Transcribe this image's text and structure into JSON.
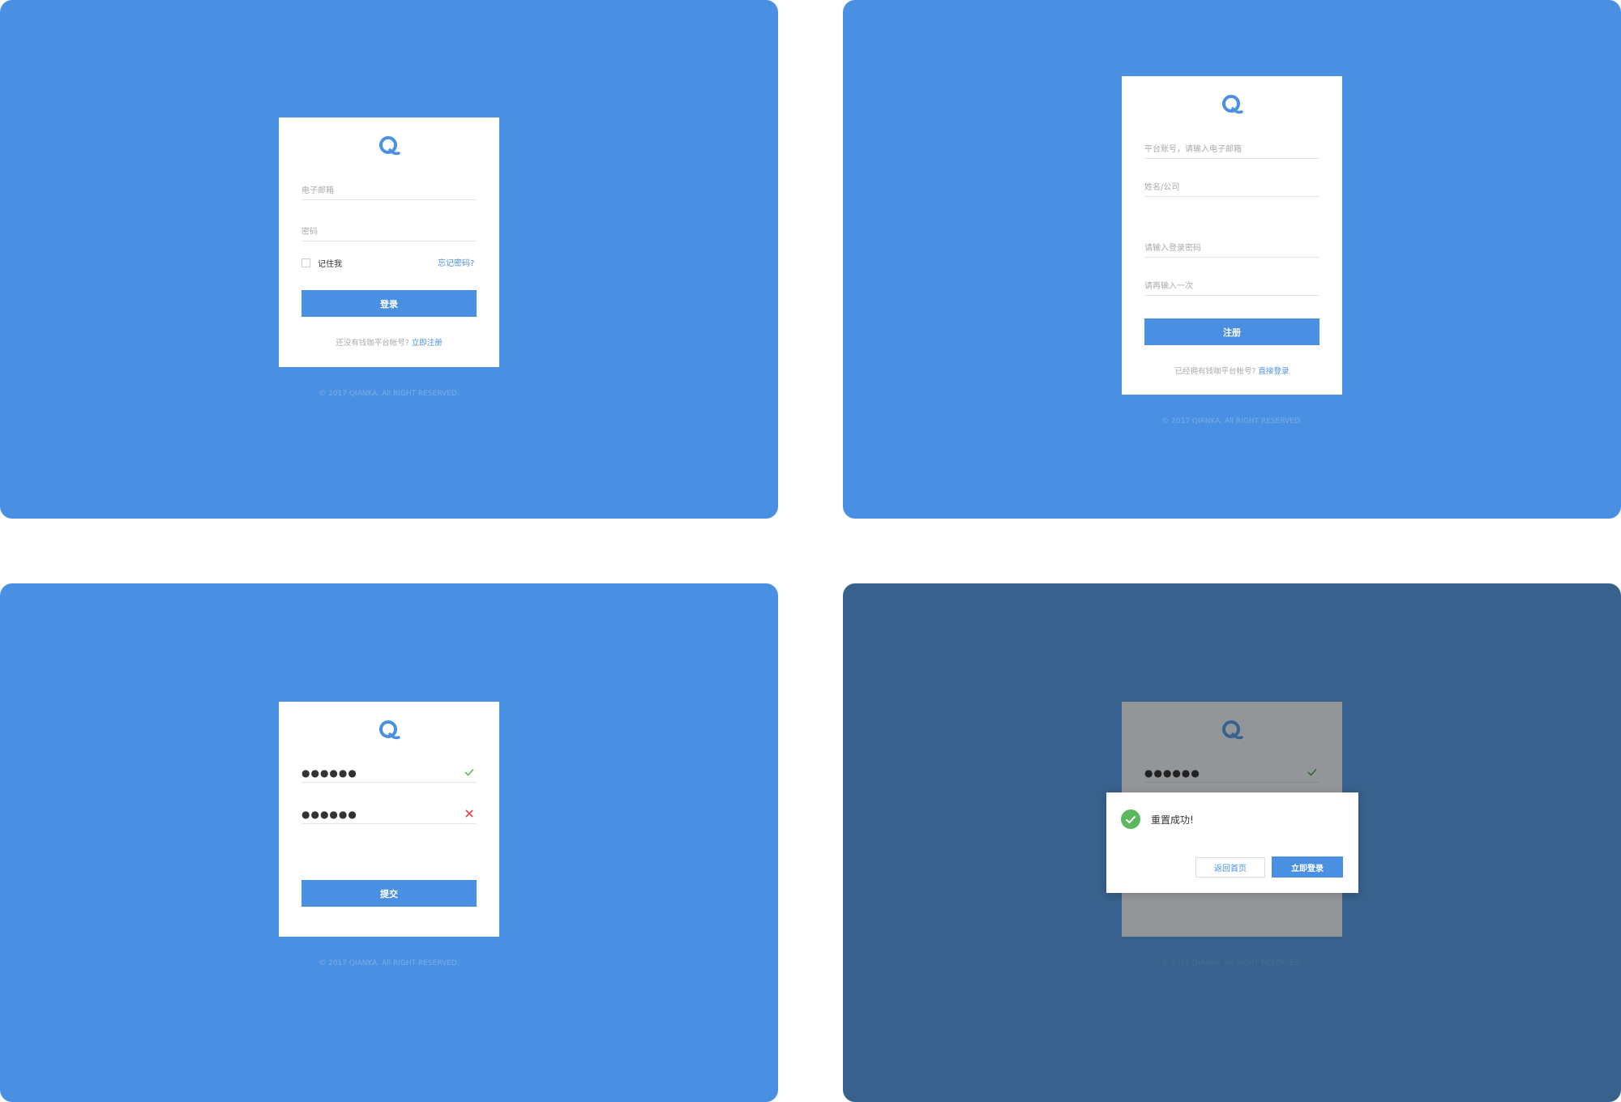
{
  "login": {
    "email_placeholder": "电子邮箱",
    "password_placeholder": "密码",
    "remember_label": "记住我",
    "forgot_link": "忘记密码?",
    "login_button": "登录",
    "register_prompt": "还没有钱咖平台帐号?",
    "register_link": "立即注册",
    "footer": "© 2017 QIANKA. All RIGHT RESERVED."
  },
  "register": {
    "account_placeholder": "平台账号，请输入电子邮箱",
    "name_placeholder": "姓名/公司",
    "password_placeholder": "请输入登录密码",
    "confirm_placeholder": "请再输入一次",
    "register_button": "注册",
    "login_prompt": "已经拥有钱咖平台帐号?",
    "login_link": "直接登录",
    "footer": "© 2017 QIANKA. All RIGHT RESERVED."
  },
  "reset": {
    "password_value": "●●●●●●",
    "confirm_value": "●●●●●●",
    "submit_button": "提交",
    "footer": "© 2017 QIANKA. All RIGHT RESERVED."
  },
  "success": {
    "password_value": "●●●●●●",
    "message": "重置成功!",
    "back_button": "返回首页",
    "login_button": "立即登录",
    "footer": "© 2017 QIANKA. All RIGHT RESERVED."
  },
  "icons": {
    "logo": "qianka-logo-icon",
    "valid": "check-icon",
    "invalid": "close-icon",
    "success": "success-check-circle-icon"
  },
  "colors": {
    "primary": "#4A90E2",
    "overlay_bg": "#38618D",
    "valid": "#5CB85C",
    "invalid": "#E0434A"
  }
}
